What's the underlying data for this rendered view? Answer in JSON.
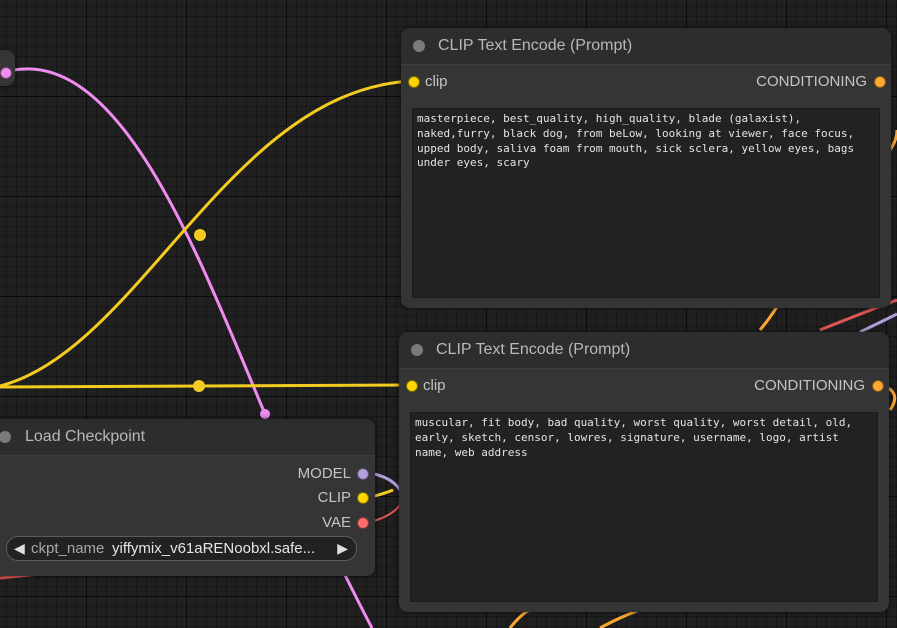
{
  "colors": {
    "clip_wire": "#f4cc21",
    "pink_wire": "#f08cf0",
    "model_slot": "#b39ddb",
    "clip_slot": "#ffd500",
    "vae_slot": "#ff6e6e",
    "conditioning_slot": "#ffa931",
    "red_wire": "#e05555"
  },
  "nodes": {
    "clip_positive": {
      "title": "CLIP Text Encode (Prompt)",
      "input_label": "clip",
      "output_label": "CONDITIONING",
      "text": "masterpiece, best_quality, high_quality, blade (galaxist),\nnaked,furry, black dog, from beLow, looking at viewer, face focus,\nupped body, saliva foam from mouth, sick sclera, yellow eyes, bags\nunder eyes, scary"
    },
    "clip_negative": {
      "title": "CLIP Text Encode (Prompt)",
      "input_label": "clip",
      "output_label": "CONDITIONING",
      "text": "muscular, fit body, bad quality, worst quality, worst detail, old,\nearly, sketch, censor, lowres, signature, username, logo, artist\nname, web address"
    },
    "load_checkpoint": {
      "title": "Load Checkpoint",
      "outputs": [
        "MODEL",
        "CLIP",
        "VAE"
      ],
      "widget_label": "ckpt_name",
      "widget_value": "yiffymix_v61aRENoobxl.safe...",
      "left_arrow": "◀",
      "right_arrow": "▶"
    }
  }
}
